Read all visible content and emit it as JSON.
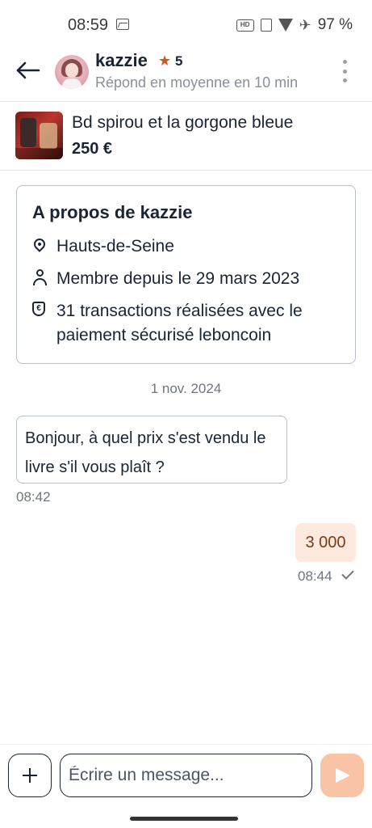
{
  "status_bar": {
    "time": "08:59",
    "battery": "97 %"
  },
  "header": {
    "user_name": "kazzie",
    "rating": "5",
    "response_time": "Répond en moyenne en 10 min"
  },
  "product": {
    "title": "Bd spirou et la gorgone bleue",
    "price": "250 €"
  },
  "about": {
    "title": "A propos de kazzie",
    "location": "Hauts-de-Seine",
    "member_since": "Membre depuis le 29 mars 2023",
    "transactions": "31 transactions réalisées avec le paiement sécurisé leboncoin"
  },
  "conversation": {
    "date": "1 nov. 2024",
    "messages": [
      {
        "direction": "in",
        "text": "Bonjour, à quel prix s'est vendu le livre s'il vous plaît ?",
        "time": "08:42"
      },
      {
        "direction": "out",
        "text": "3 000",
        "time": "08:44"
      }
    ]
  },
  "composer": {
    "placeholder": "Écrire un message..."
  },
  "colors": {
    "accent": "#d4571c",
    "outgoing_bubble": "#fde9de",
    "send_button": "#f8c4a5",
    "text": "#1a2433"
  },
  "icons": [
    "image-icon",
    "hd-icon",
    "vibrate-icon",
    "wifi-icon",
    "airplane-icon",
    "back-arrow-icon",
    "star-icon",
    "more-vertical-icon",
    "location-pin-icon",
    "person-icon",
    "shield-euro-icon",
    "check-icon",
    "plus-icon",
    "send-icon"
  ]
}
